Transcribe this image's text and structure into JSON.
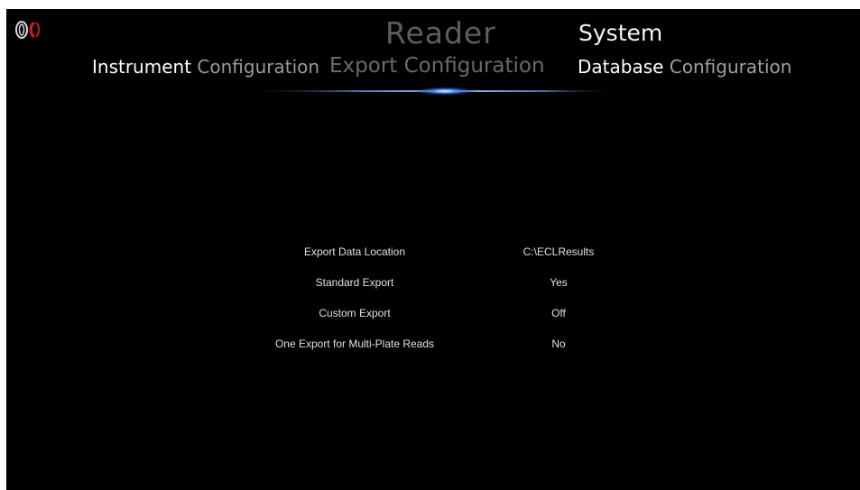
{
  "header": {
    "primary": "Reader",
    "secondary": "System"
  },
  "tabs": [
    {
      "strong": "Instrument",
      "rest": " Configuration"
    },
    {
      "label": "Export Configuration"
    },
    {
      "strong": "Database",
      "rest": " Configuration"
    }
  ],
  "settings": [
    {
      "label": "Export Data Location",
      "value": "C:\\ECLResults"
    },
    {
      "label": "Standard Export",
      "value": "Yes"
    },
    {
      "label": "Custom Export",
      "value": "Off"
    },
    {
      "label": "One Export for Multi-Plate Reads",
      "value": "No"
    }
  ],
  "colors": {
    "background": "#000000",
    "accent_glow": "#3a7bff",
    "logo_red": "#d0181f"
  },
  "icons": {
    "logo": "brand-logo-icon"
  }
}
